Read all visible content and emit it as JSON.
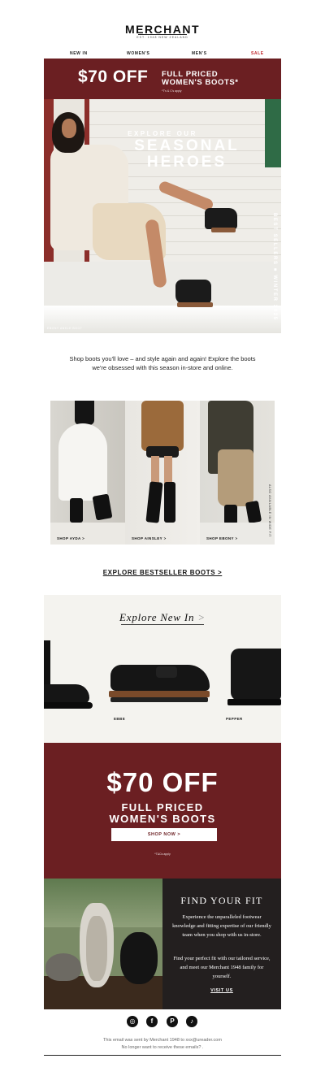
{
  "header": {
    "logo": "MERCHANT",
    "logo_sub": "EST. 1948 NEW ZEALAND",
    "nav": [
      {
        "label": "NEW IN"
      },
      {
        "label": "WOMEN'S"
      },
      {
        "label": "MEN'S"
      },
      {
        "label": "SALE"
      }
    ]
  },
  "top_banner": {
    "amount": "$70 OFF",
    "line1": "FULL PRICED",
    "line2": "WOMEN'S BOOTS*",
    "terms": "*T's & C's apply"
  },
  "hero": {
    "eyebrow": "EXPLORE OUR",
    "title_line1": "SEASONAL",
    "title_line2": "HEROES",
    "caption": "EBONY ANKLE BOOT",
    "vertical": "BEST SELLERS ■ WINTER 2025"
  },
  "intro": {
    "text": "Shop boots you'll love – and style again and again! Explore the boots we're obsessed with this season in-store and online."
  },
  "products": [
    {
      "label": "SHOP AYDA >"
    },
    {
      "label": "SHOP AINSLEY >"
    },
    {
      "label": "SHOP EBONY >"
    }
  ],
  "products_vertical": "ALSO AVAILABLE IN WIDE FIT",
  "bestseller_link": "EXPLORE BESTSELLER BOOTS >",
  "new_in": {
    "title": "Explore New In",
    "arrow": ">",
    "items": [
      {
        "label": "EBBE"
      },
      {
        "label": "PEPPER"
      }
    ]
  },
  "offer": {
    "amount": "$70 OFF",
    "line1": "FULL PRICED",
    "line2": "WOMEN'S BOOTS",
    "button": "SHOP NOW >",
    "terms": "*T&Cs apply"
  },
  "fit": {
    "title": "FIND YOUR FIT",
    "para1": "Experience the unparalleled footwear knowledge and fitting expertise of our friendly team when you shop with us in-store.",
    "para2": "Find your perfect fit with our tailored service, and meet our Merchant 1948 family for yourself.",
    "link": "VISIT US"
  },
  "social": [
    {
      "icon": "instagram-icon",
      "glyph": "◎"
    },
    {
      "icon": "facebook-icon",
      "glyph": "f"
    },
    {
      "icon": "pinterest-icon",
      "glyph": "P"
    },
    {
      "icon": "tiktok-icon",
      "glyph": "♪"
    }
  ],
  "footer": {
    "line1": "This email was sent by Merchant 1948 to xxx@ureader.com",
    "line2": "No longer want to receive these emails? ."
  },
  "colors": {
    "brand_maroon": "#6b1f22",
    "sale_red": "#c0262b",
    "dark_panel": "#231f1f"
  }
}
